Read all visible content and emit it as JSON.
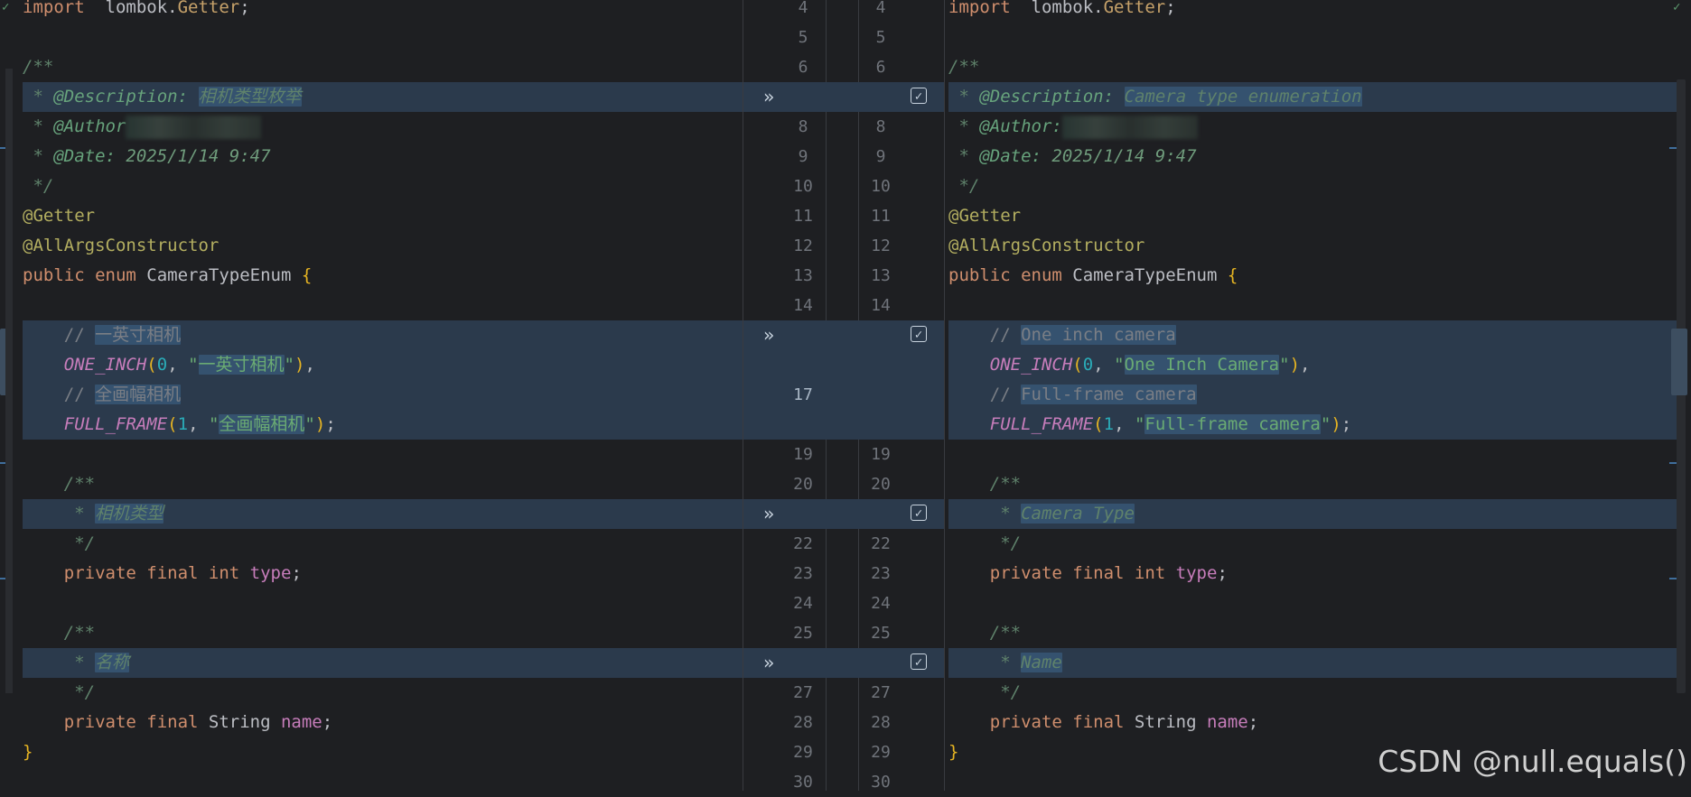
{
  "left": {
    "lines": [
      {
        "parts": [
          [
            "kw",
            "import"
          ],
          [
            "",
            "  lombok."
          ],
          [
            "pkgcls",
            "Getter"
          ],
          [
            "",
            ";"
          ]
        ]
      },
      {
        "parts": []
      },
      {
        "parts": [
          [
            "doc",
            "/**"
          ]
        ]
      },
      {
        "changed": true,
        "parts": [
          [
            "doc",
            " * "
          ],
          [
            "doctag",
            "@Description:"
          ],
          [
            "doc",
            " "
          ],
          [
            "doc hl",
            "相机类型枚举"
          ]
        ]
      },
      {
        "parts": [
          [
            "doc",
            " * "
          ],
          [
            "doctag",
            "@Author"
          ]
        ],
        "blur": true
      },
      {
        "parts": [
          [
            "doc",
            " * "
          ],
          [
            "doctag",
            "@Date:"
          ],
          [
            "docval",
            " 2025/1/14 9:47"
          ]
        ]
      },
      {
        "parts": [
          [
            "doc",
            " */"
          ]
        ]
      },
      {
        "parts": [
          [
            "ann",
            "@Getter"
          ]
        ]
      },
      {
        "parts": [
          [
            "ann",
            "@AllArgsConstructor"
          ]
        ]
      },
      {
        "parts": [
          [
            "kw",
            "public enum "
          ],
          [
            "",
            "CameraTypeEnum "
          ],
          [
            "brace",
            "{"
          ]
        ]
      },
      {
        "parts": []
      },
      {
        "changed": true,
        "parts": [
          [
            "cmt",
            "    // "
          ],
          [
            "cmt hl",
            "一英寸相机"
          ]
        ]
      },
      {
        "changed": true,
        "parts": [
          [
            "enumc",
            "    ONE_INCH"
          ],
          [
            "brace",
            "("
          ],
          [
            "num",
            "0"
          ],
          [
            "",
            ", "
          ],
          [
            "str",
            "\""
          ],
          [
            "str hl",
            "一英寸相机"
          ],
          [
            "str",
            "\""
          ],
          [
            "brace",
            ")"
          ],
          [
            "",
            ","
          ]
        ]
      },
      {
        "changed": true,
        "parts": [
          [
            "cmt",
            "    // "
          ],
          [
            "cmt hl",
            "全画幅相机"
          ]
        ]
      },
      {
        "changed": true,
        "parts": [
          [
            "enumc",
            "    FULL_FRAME"
          ],
          [
            "brace",
            "("
          ],
          [
            "num",
            "1"
          ],
          [
            "",
            ", "
          ],
          [
            "str",
            "\""
          ],
          [
            "str hl",
            "全画幅相机"
          ],
          [
            "str",
            "\""
          ],
          [
            "brace",
            ")"
          ],
          [
            "",
            ";"
          ]
        ]
      },
      {
        "parts": []
      },
      {
        "parts": [
          [
            "doc",
            "    /**"
          ]
        ]
      },
      {
        "changed": true,
        "parts": [
          [
            "doc",
            "     * "
          ],
          [
            "doc hl",
            "相机类型"
          ]
        ]
      },
      {
        "parts": [
          [
            "doc",
            "     */"
          ]
        ]
      },
      {
        "parts": [
          [
            "kw",
            "    private final int "
          ],
          [
            "field",
            "type"
          ],
          [
            "",
            ";"
          ]
        ]
      },
      {
        "parts": []
      },
      {
        "parts": [
          [
            "doc",
            "    /**"
          ]
        ]
      },
      {
        "changed": true,
        "parts": [
          [
            "doc",
            "     * "
          ],
          [
            "doc hl",
            "名称"
          ]
        ]
      },
      {
        "parts": [
          [
            "doc",
            "     */"
          ]
        ]
      },
      {
        "parts": [
          [
            "kw",
            "    private final "
          ],
          [
            "",
            "String "
          ],
          [
            "field",
            "name"
          ],
          [
            "",
            ";"
          ]
        ]
      },
      {
        "parts": [
          [
            "brace",
            "}"
          ]
        ]
      },
      {
        "parts": []
      }
    ]
  },
  "right": {
    "lines": [
      {
        "parts": [
          [
            "kw",
            "import"
          ],
          [
            "",
            "  lombok."
          ],
          [
            "pkgcls",
            "Getter"
          ],
          [
            "",
            ";"
          ]
        ]
      },
      {
        "parts": []
      },
      {
        "parts": [
          [
            "doc",
            "/**"
          ]
        ]
      },
      {
        "changed": true,
        "parts": [
          [
            "doc",
            " * "
          ],
          [
            "doctag",
            "@Description:"
          ],
          [
            "doc",
            " "
          ],
          [
            "doc hl",
            "Camera type enumeration"
          ]
        ]
      },
      {
        "parts": [
          [
            "doc",
            " * "
          ],
          [
            "doctag",
            "@Author:"
          ]
        ],
        "blur": true
      },
      {
        "parts": [
          [
            "doc",
            " * "
          ],
          [
            "doctag",
            "@Date:"
          ],
          [
            "docval",
            " 2025/1/14 9:47"
          ]
        ]
      },
      {
        "parts": [
          [
            "doc",
            " */"
          ]
        ]
      },
      {
        "parts": [
          [
            "ann",
            "@Getter"
          ]
        ]
      },
      {
        "parts": [
          [
            "ann",
            "@AllArgsConstructor"
          ]
        ]
      },
      {
        "parts": [
          [
            "kw",
            "public enum "
          ],
          [
            "",
            "CameraTypeEnum "
          ],
          [
            "brace",
            "{"
          ]
        ]
      },
      {
        "parts": []
      },
      {
        "changed": true,
        "parts": [
          [
            "cmt",
            "    // "
          ],
          [
            "cmt hl",
            "One inch camera"
          ]
        ]
      },
      {
        "changed": true,
        "parts": [
          [
            "enumc",
            "    ONE_INCH"
          ],
          [
            "brace",
            "("
          ],
          [
            "num",
            "0"
          ],
          [
            "",
            ", "
          ],
          [
            "str",
            "\""
          ],
          [
            "str hl",
            "One Inch Camera"
          ],
          [
            "str",
            "\""
          ],
          [
            "brace",
            ")"
          ],
          [
            "",
            ","
          ]
        ]
      },
      {
        "changed": true,
        "parts": [
          [
            "cmt",
            "    // "
          ],
          [
            "cmt hl",
            "Full-frame camera"
          ]
        ]
      },
      {
        "changed": true,
        "parts": [
          [
            "enumc",
            "    FULL_FRAME"
          ],
          [
            "brace",
            "("
          ],
          [
            "num",
            "1"
          ],
          [
            "",
            ", "
          ],
          [
            "str",
            "\""
          ],
          [
            "str hl",
            "Full-frame camera"
          ],
          [
            "str",
            "\""
          ],
          [
            "brace",
            ")"
          ],
          [
            "",
            ";"
          ]
        ]
      },
      {
        "parts": []
      },
      {
        "parts": [
          [
            "doc",
            "    /**"
          ]
        ]
      },
      {
        "changed": true,
        "parts": [
          [
            "doc",
            "     * "
          ],
          [
            "doc hl",
            "Camera Type"
          ]
        ]
      },
      {
        "parts": [
          [
            "doc",
            "     */"
          ]
        ]
      },
      {
        "parts": [
          [
            "kw",
            "    private final int "
          ],
          [
            "field",
            "type"
          ],
          [
            "",
            ";"
          ]
        ]
      },
      {
        "parts": []
      },
      {
        "parts": [
          [
            "doc",
            "    /**"
          ]
        ]
      },
      {
        "changed": true,
        "parts": [
          [
            "doc",
            "     * "
          ],
          [
            "doc hl",
            "Name"
          ]
        ]
      },
      {
        "parts": [
          [
            "doc",
            "     */"
          ]
        ]
      },
      {
        "parts": [
          [
            "kw",
            "    private final "
          ],
          [
            "",
            "String "
          ],
          [
            "field",
            "name"
          ],
          [
            "",
            ";"
          ]
        ]
      },
      {
        "parts": [
          [
            "brace",
            "}"
          ]
        ]
      },
      {
        "parts": []
      }
    ]
  },
  "gutter": {
    "lines": [
      {
        "left": "4",
        "right": "4"
      },
      {
        "left": "5",
        "right": "5"
      },
      {
        "left": "6",
        "right": "6"
      },
      {
        "left": "",
        "right": "",
        "changed": true,
        "accept": true
      },
      {
        "left": "8",
        "right": "8"
      },
      {
        "left": "9",
        "right": "9"
      },
      {
        "left": "10",
        "right": "10"
      },
      {
        "left": "11",
        "right": "11"
      },
      {
        "left": "12",
        "right": "12"
      },
      {
        "left": "13",
        "right": "13"
      },
      {
        "left": "14",
        "right": "14"
      },
      {
        "left": "",
        "right": "",
        "changed": true,
        "accept": true
      },
      {
        "left": "",
        "right": "",
        "changed": true
      },
      {
        "left": "17",
        "right": "",
        "changed": true,
        "current": true
      },
      {
        "left": "",
        "right": "",
        "changed": true
      },
      {
        "left": "19",
        "right": "19"
      },
      {
        "left": "20",
        "right": "20"
      },
      {
        "left": "",
        "right": "",
        "changed": true,
        "accept": true
      },
      {
        "left": "22",
        "right": "22"
      },
      {
        "left": "23",
        "right": "23"
      },
      {
        "left": "24",
        "right": "24"
      },
      {
        "left": "25",
        "right": "25"
      },
      {
        "left": "",
        "right": "",
        "changed": true,
        "accept": true
      },
      {
        "left": "27",
        "right": "27"
      },
      {
        "left": "28",
        "right": "28"
      },
      {
        "left": "29",
        "right": "29"
      },
      {
        "left": "30",
        "right": "30"
      }
    ],
    "accept_glyph": "»",
    "check_glyph": "✓"
  },
  "watermark": "CSDN @null.equals()",
  "colors": {
    "background": "#1e1f22",
    "changed_bg": "#2b3a4c",
    "highlight": "#35526f"
  }
}
